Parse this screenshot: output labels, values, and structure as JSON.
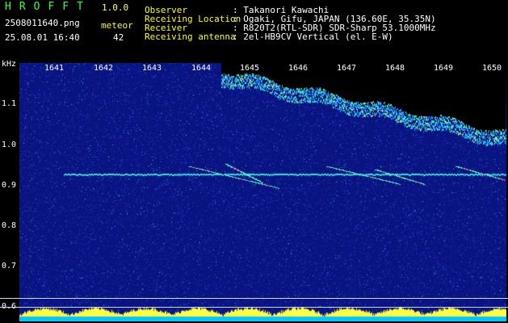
{
  "app": {
    "title": "HROFFT",
    "version": "1.0.0"
  },
  "file": {
    "name": "2508011640.png",
    "datetime": "25.08.01 16:40"
  },
  "meteor": {
    "label": "meteor",
    "count": "42"
  },
  "info": [
    {
      "key": "Observer",
      "value": ": Takanori Kawachi"
    },
    {
      "key": "Receiving Location",
      "value": ": Ogaki, Gifu, JAPAN (136.60E, 35.35N)"
    },
    {
      "key": "Receiver",
      "value": ": R820T2(RTL-SDR) SDR-Sharp 53.1000MHz"
    },
    {
      "key": "Receiving antenna",
      "value": ": 2el-HB9CV Vertical (el. E-W)"
    }
  ],
  "axis": {
    "y_unit": "kHz",
    "x_ticks": [
      "1641",
      "1642",
      "1643",
      "1644",
      "1645",
      "1646",
      "1647",
      "1648",
      "1649",
      "1650"
    ],
    "y_ticks": [
      "1.1",
      "1.0",
      "0.9",
      "0.8",
      "0.7",
      "0.6"
    ]
  },
  "colors": {
    "background": "#000000",
    "noise": "#0d1a8c",
    "echo": "#33ccff",
    "header_text": "#ffff66"
  }
}
